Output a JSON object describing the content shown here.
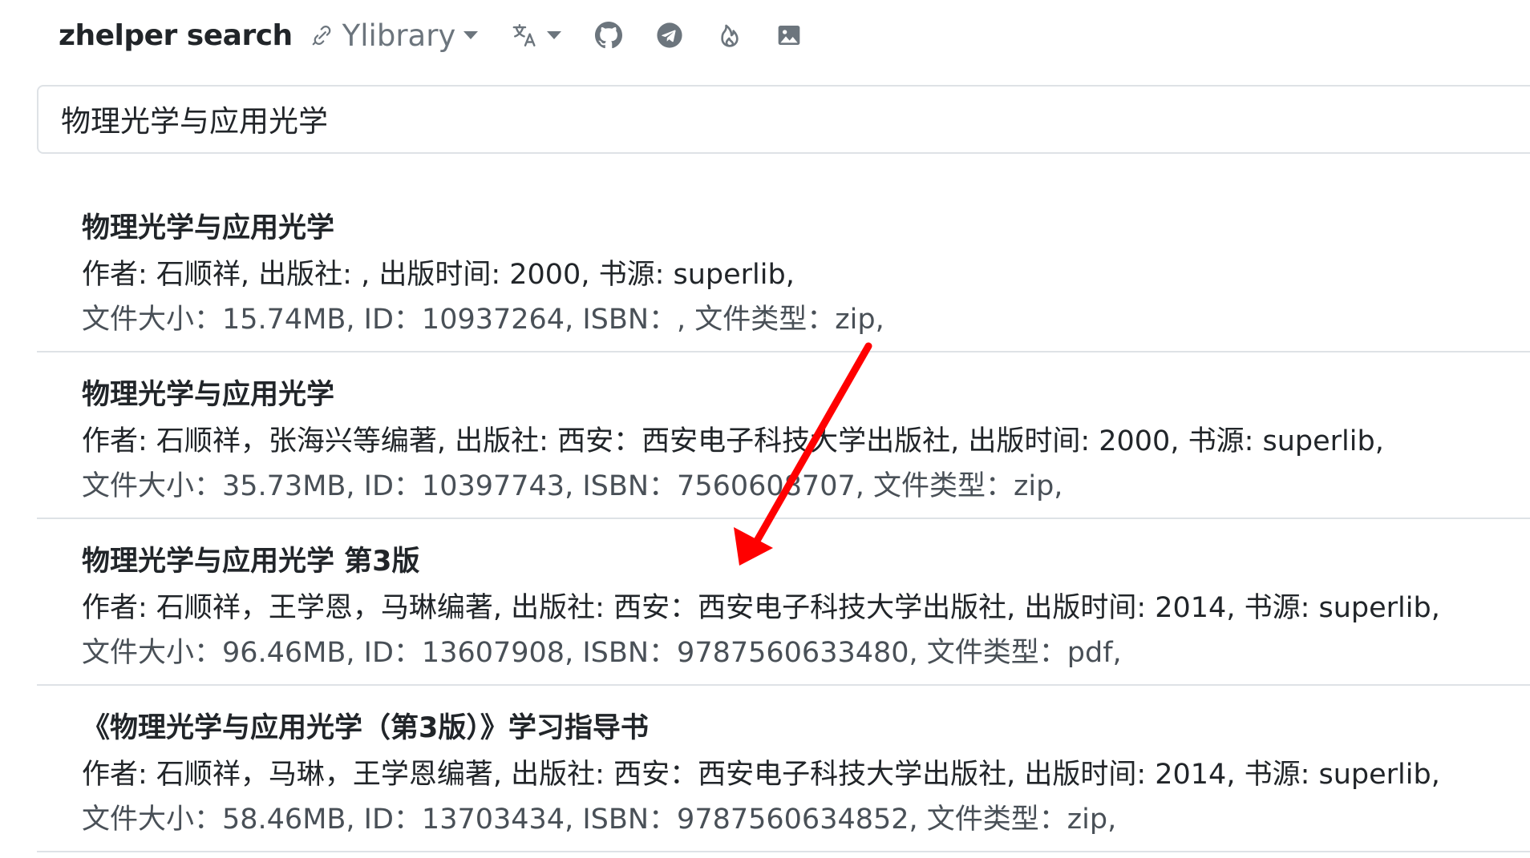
{
  "header": {
    "brand": "zhelper search",
    "library_selector": "Ylibrary",
    "icons": [
      "link-icon",
      "translate-icon",
      "github-icon",
      "telegram-icon",
      "fire-icon",
      "image-icon"
    ]
  },
  "search": {
    "value": "物理光学与应用光学"
  },
  "results": [
    {
      "title": "物理光学与应用光学",
      "meta_line1": "作者: 石顺祥, 出版社: , 出版时间: 2000, 书源: superlib,",
      "meta_line2": "文件大小：15.74MB, ID：10937264, ISBN：, 文件类型：zip,"
    },
    {
      "title": "物理光学与应用光学",
      "meta_line1": "作者: 石顺祥，张海兴等编著, 出版社: 西安：西安电子科技大学出版社, 出版时间: 2000, 书源: superlib,",
      "meta_line2": "文件大小：35.73MB, ID：10397743, ISBN：7560608707, 文件类型：zip,"
    },
    {
      "title": "物理光学与应用光学 第3版",
      "meta_line1": "作者: 石顺祥，王学恩，马琳编著, 出版社: 西安：西安电子科技大学出版社, 出版时间: 2014, 书源: superlib,",
      "meta_line2": "文件大小：96.46MB, ID：13607908, ISBN：9787560633480, 文件类型：pdf,"
    },
    {
      "title": "《物理光学与应用光学（第3版）》学习指导书",
      "meta_line1": "作者: 石顺祥，马琳，王学恩编著, 出版社: 西安：西安电子科技大学出版社, 出版时间: 2014, 书源: superlib,",
      "meta_line2": "文件大小：58.46MB, ID：13703434, ISBN：9787560634852, 文件类型：zip,"
    }
  ],
  "colors": {
    "text": "#212529",
    "muted": "#6c757d",
    "border": "#dee2e6",
    "annotation_arrow": "#ff0000"
  }
}
